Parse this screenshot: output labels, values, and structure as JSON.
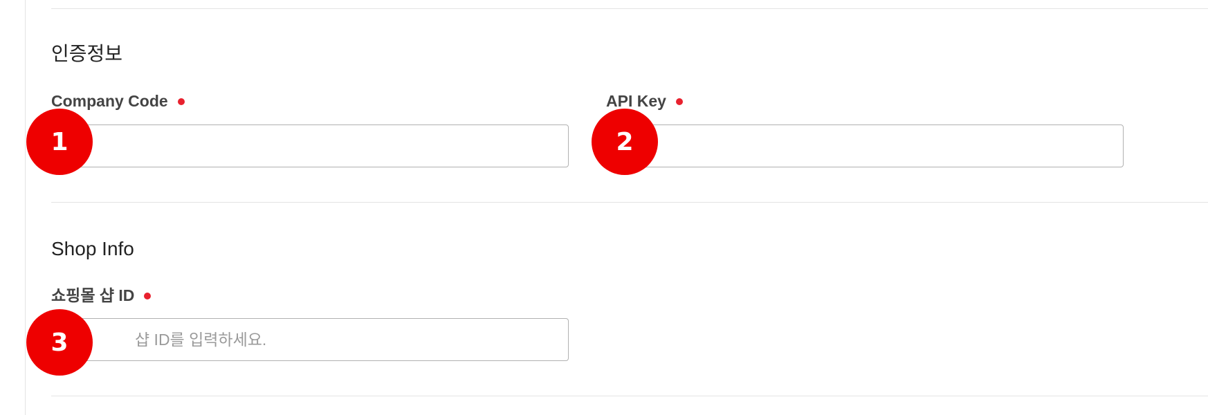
{
  "auth_section": {
    "title": "인증정보",
    "company_code": {
      "label": "Company Code",
      "value": "",
      "placeholder": ""
    },
    "api_key": {
      "label": "API Key",
      "value": "",
      "placeholder": ""
    }
  },
  "shop_section": {
    "title": "Shop Info",
    "shop_id": {
      "label": "쇼핑몰 샵 ID",
      "value": "",
      "placeholder": "샵 ID를 입력하세요."
    }
  },
  "markers": [
    "1",
    "2",
    "3"
  ],
  "colors": {
    "required_dot": "#e8212e",
    "marker": "#ee0000",
    "divider": "#e3e3e3",
    "input_border": "#b0b0b0"
  }
}
